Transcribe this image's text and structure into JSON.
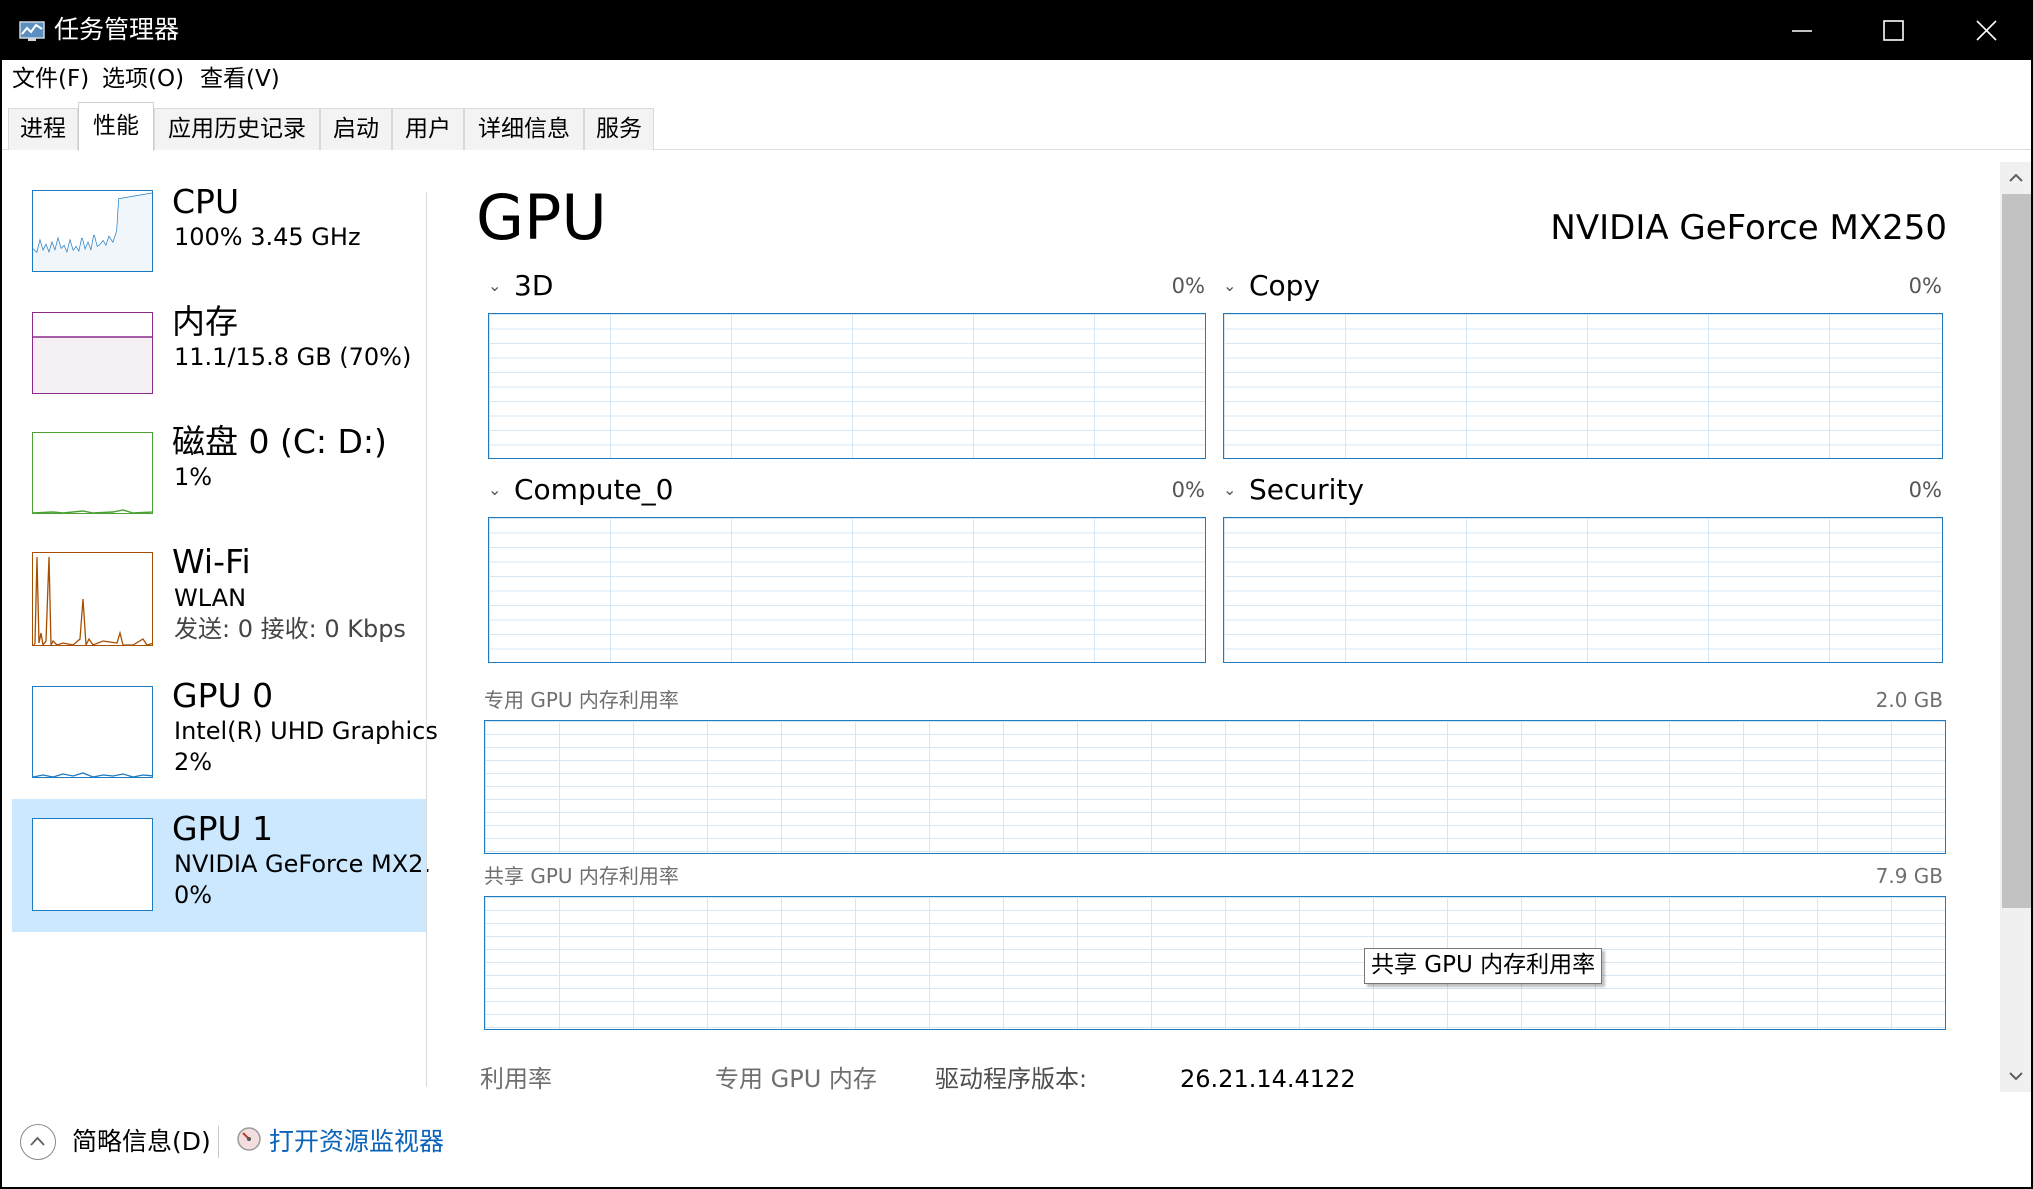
{
  "window": {
    "title": "任务管理器",
    "app_icon": "task-manager-icon",
    "controls": [
      "minimize-icon",
      "maximize-icon",
      "close-icon"
    ]
  },
  "menu": [
    "文件(F)",
    "选项(O)",
    "查看(V)"
  ],
  "tabs": [
    {
      "label": "进程",
      "active": false
    },
    {
      "label": "性能",
      "active": true
    },
    {
      "label": "应用历史记录",
      "active": false
    },
    {
      "label": "启动",
      "active": false
    },
    {
      "label": "用户",
      "active": false
    },
    {
      "label": "详细信息",
      "active": false
    },
    {
      "label": "服务",
      "active": false
    }
  ],
  "sidebar": [
    {
      "title": "CPU",
      "line1": "100% 3.45 GHz",
      "line2": "",
      "color": "#1f7bc1",
      "selected": false
    },
    {
      "title": "内存",
      "line1": "11.1/15.8 GB (70%)",
      "line2": "",
      "color": "#8b2a8b",
      "selected": false
    },
    {
      "title": "磁盘 0 (C: D:)",
      "line1": "1%",
      "line2": "",
      "color": "#4da033",
      "selected": false
    },
    {
      "title": "Wi-Fi",
      "line1": "WLAN",
      "line2": "发送: 0 接收: 0 Kbps",
      "color": "#a74f01",
      "selected": false
    },
    {
      "title": "GPU 0",
      "line1": "Intel(R) UHD Graphics",
      "line2": "2%",
      "color": "#1f7bc1",
      "selected": false
    },
    {
      "title": "GPU 1",
      "line1": "NVIDIA GeForce MX2.",
      "line2": "0%",
      "color": "#1f7bc1",
      "selected": true
    }
  ],
  "main": {
    "title": "GPU",
    "device_name": "NVIDIA GeForce MX250",
    "engines": [
      {
        "name": "3D",
        "value": "0%"
      },
      {
        "name": "Copy",
        "value": "0%"
      },
      {
        "name": "Compute_0",
        "value": "0%"
      },
      {
        "name": "Security",
        "value": "0%"
      }
    ],
    "dedicated_memory": {
      "label": "专用 GPU 内存利用率",
      "capacity": "2.0 GB"
    },
    "shared_memory": {
      "label": "共享 GPU 内存利用率",
      "capacity": "7.9 GB"
    },
    "tooltip": "共享 GPU 内存利用率",
    "stats": {
      "utilization_label": "利用率",
      "dedicated_label": "专用 GPU 内存",
      "driver_label": "驱动程序版本:",
      "driver_value": "26.21.14.4122"
    }
  },
  "bottom": {
    "brief_label": "简略信息(D)",
    "resmon_link": "打开资源监视器"
  }
}
